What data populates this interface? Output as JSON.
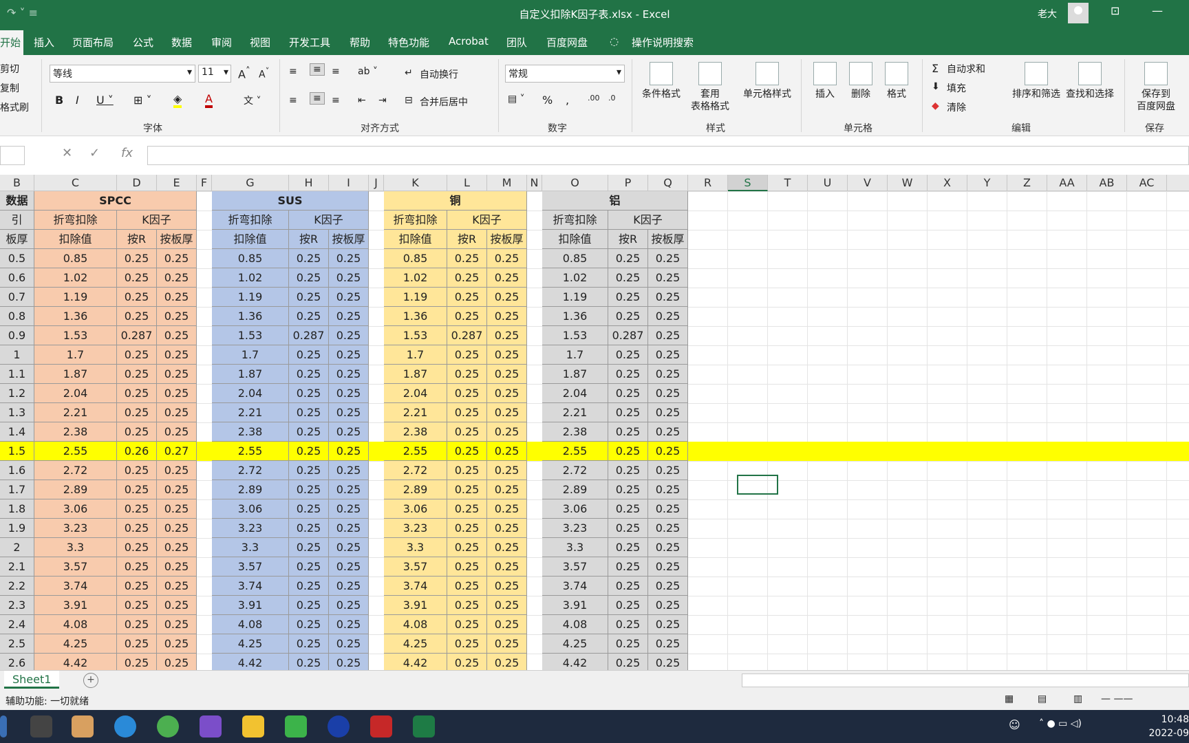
{
  "window": {
    "title": "自定义扣除K因子表.xlsx  -  Excel",
    "user": "老大"
  },
  "menu": [
    "开始",
    "插入",
    "页面布局",
    "公式",
    "数据",
    "审阅",
    "视图",
    "开发工具",
    "帮助",
    "特色功能",
    "Acrobat",
    "团队",
    "百度网盘",
    "操作说明搜索"
  ],
  "ribbon": {
    "clipboard": [
      "剪切",
      "复制",
      "格式刷"
    ],
    "font_name": "等线",
    "font_size": "11",
    "font_group": "字体",
    "wrap_text": "自动换行",
    "merge_center": "合并后居中",
    "align_group": "对齐方式",
    "number_format": "常规",
    "number_group": "数字",
    "cond_format": "条件格式",
    "table_format": "套用\n表格格式",
    "cell_style": "单元格样式",
    "styles_group": "样式",
    "insert": "插入",
    "delete": "删除",
    "format": "格式",
    "cells_group": "单元格",
    "autosum": "自动求和",
    "fill": "填充",
    "clear": "清除",
    "sort_filter": "排序和筛选",
    "find_select": "查找和选择",
    "edit_group": "编辑",
    "save_baidu": "保存到\n百度网盘",
    "save_group": "保存"
  },
  "colors": {
    "spcc": "#f8cbad",
    "sus": "#b4c6e7",
    "cu": "#ffe699",
    "al": "#d9d9d9",
    "hl": "#ffff00",
    "brand": "#217346"
  },
  "col_headers": [
    "B",
    "C",
    "D",
    "E",
    "F",
    "G",
    "H",
    "I",
    "J",
    "K",
    "L",
    "M",
    "N",
    "O",
    "P",
    "Q",
    "R",
    "S",
    "T",
    "U",
    "V",
    "W",
    "X",
    "Y",
    "Z",
    "AA",
    "AB",
    "AC"
  ],
  "headers": {
    "row1_a": "数据",
    "spcc": "SPCC",
    "sus": "SUS",
    "cu": "铜",
    "al": "铝",
    "row2_a": "引",
    "bend": "折弯扣除",
    "kf": "K因子",
    "row3_a": "板厚",
    "ded": "扣除值",
    "byr": "按R",
    "byt": "按板厚"
  },
  "rows": [
    [
      "0.5",
      "0.85",
      "0.25",
      "0.25",
      "0.85",
      "0.25",
      "0.25",
      "0.85",
      "0.25",
      "0.25",
      "0.85",
      "0.25",
      "0.25"
    ],
    [
      "0.6",
      "1.02",
      "0.25",
      "0.25",
      "1.02",
      "0.25",
      "0.25",
      "1.02",
      "0.25",
      "0.25",
      "1.02",
      "0.25",
      "0.25"
    ],
    [
      "0.7",
      "1.19",
      "0.25",
      "0.25",
      "1.19",
      "0.25",
      "0.25",
      "1.19",
      "0.25",
      "0.25",
      "1.19",
      "0.25",
      "0.25"
    ],
    [
      "0.8",
      "1.36",
      "0.25",
      "0.25",
      "1.36",
      "0.25",
      "0.25",
      "1.36",
      "0.25",
      "0.25",
      "1.36",
      "0.25",
      "0.25"
    ],
    [
      "0.9",
      "1.53",
      "0.287",
      "0.25",
      "1.53",
      "0.287",
      "0.25",
      "1.53",
      "0.287",
      "0.25",
      "1.53",
      "0.287",
      "0.25"
    ],
    [
      "1",
      "1.7",
      "0.25",
      "0.25",
      "1.7",
      "0.25",
      "0.25",
      "1.7",
      "0.25",
      "0.25",
      "1.7",
      "0.25",
      "0.25"
    ],
    [
      "1.1",
      "1.87",
      "0.25",
      "0.25",
      "1.87",
      "0.25",
      "0.25",
      "1.87",
      "0.25",
      "0.25",
      "1.87",
      "0.25",
      "0.25"
    ],
    [
      "1.2",
      "2.04",
      "0.25",
      "0.25",
      "2.04",
      "0.25",
      "0.25",
      "2.04",
      "0.25",
      "0.25",
      "2.04",
      "0.25",
      "0.25"
    ],
    [
      "1.3",
      "2.21",
      "0.25",
      "0.25",
      "2.21",
      "0.25",
      "0.25",
      "2.21",
      "0.25",
      "0.25",
      "2.21",
      "0.25",
      "0.25"
    ],
    [
      "1.4",
      "2.38",
      "0.25",
      "0.25",
      "2.38",
      "0.25",
      "0.25",
      "2.38",
      "0.25",
      "0.25",
      "2.38",
      "0.25",
      "0.25"
    ],
    [
      "1.5",
      "2.55",
      "0.26",
      "0.27",
      "2.55",
      "0.25",
      "0.25",
      "2.55",
      "0.25",
      "0.25",
      "2.55",
      "0.25",
      "0.25"
    ],
    [
      "1.6",
      "2.72",
      "0.25",
      "0.25",
      "2.72",
      "0.25",
      "0.25",
      "2.72",
      "0.25",
      "0.25",
      "2.72",
      "0.25",
      "0.25"
    ],
    [
      "1.7",
      "2.89",
      "0.25",
      "0.25",
      "2.89",
      "0.25",
      "0.25",
      "2.89",
      "0.25",
      "0.25",
      "2.89",
      "0.25",
      "0.25"
    ],
    [
      "1.8",
      "3.06",
      "0.25",
      "0.25",
      "3.06",
      "0.25",
      "0.25",
      "3.06",
      "0.25",
      "0.25",
      "3.06",
      "0.25",
      "0.25"
    ],
    [
      "1.9",
      "3.23",
      "0.25",
      "0.25",
      "3.23",
      "0.25",
      "0.25",
      "3.23",
      "0.25",
      "0.25",
      "3.23",
      "0.25",
      "0.25"
    ],
    [
      "2",
      "3.3",
      "0.25",
      "0.25",
      "3.3",
      "0.25",
      "0.25",
      "3.3",
      "0.25",
      "0.25",
      "3.3",
      "0.25",
      "0.25"
    ],
    [
      "2.1",
      "3.57",
      "0.25",
      "0.25",
      "3.57",
      "0.25",
      "0.25",
      "3.57",
      "0.25",
      "0.25",
      "3.57",
      "0.25",
      "0.25"
    ],
    [
      "2.2",
      "3.74",
      "0.25",
      "0.25",
      "3.74",
      "0.25",
      "0.25",
      "3.74",
      "0.25",
      "0.25",
      "3.74",
      "0.25",
      "0.25"
    ],
    [
      "2.3",
      "3.91",
      "0.25",
      "0.25",
      "3.91",
      "0.25",
      "0.25",
      "3.91",
      "0.25",
      "0.25",
      "3.91",
      "0.25",
      "0.25"
    ],
    [
      "2.4",
      "4.08",
      "0.25",
      "0.25",
      "4.08",
      "0.25",
      "0.25",
      "4.08",
      "0.25",
      "0.25",
      "4.08",
      "0.25",
      "0.25"
    ],
    [
      "2.5",
      "4.25",
      "0.25",
      "0.25",
      "4.25",
      "0.25",
      "0.25",
      "4.25",
      "0.25",
      "0.25",
      "4.25",
      "0.25",
      "0.25"
    ],
    [
      "2.6",
      "4.42",
      "0.25",
      "0.25",
      "4.42",
      "0.25",
      "0.25",
      "4.42",
      "0.25",
      "0.25",
      "4.42",
      "0.25",
      "0.25"
    ]
  ],
  "highlight_row": 10,
  "selected_column": "S",
  "sheet_tab": "Sheet1",
  "status_text": "辅助功能: 一切就绪",
  "clock": {
    "time": "10:48",
    "date": "2022-09"
  }
}
